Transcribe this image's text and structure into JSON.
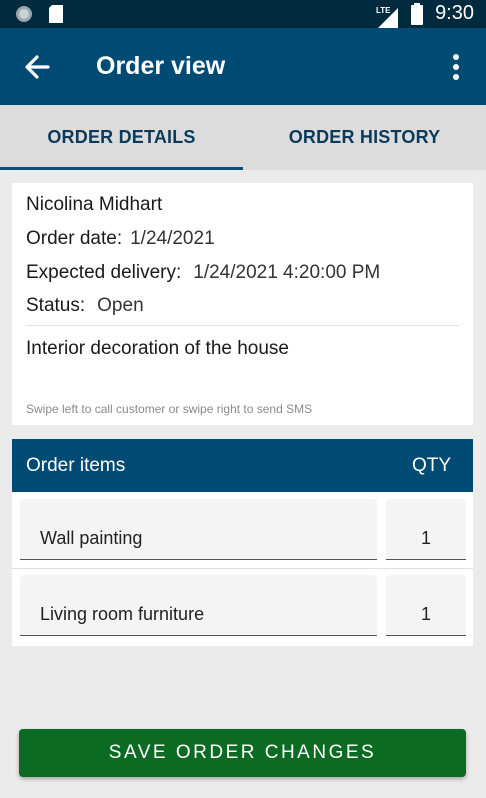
{
  "status_bar": {
    "time": "9:30",
    "network_label": "LTE",
    "icons": [
      "notification-dot-icon",
      "sd-card-icon",
      "lte-signal-icon",
      "battery-icon"
    ]
  },
  "app_bar": {
    "title": "Order view",
    "back_icon": "arrow-left-icon",
    "menu_icon": "more-vert-icon"
  },
  "tabs": [
    {
      "label": "ORDER DETAILS",
      "active": true
    },
    {
      "label": "ORDER HISTORY",
      "active": false
    }
  ],
  "details": {
    "customer_name": "Nicolina Midhart",
    "order_date_label": "Order date:",
    "order_date_value": "1/24/2021",
    "expected_delivery_label": "Expected delivery:",
    "expected_delivery_value": "1/24/2021 4:20:00 PM",
    "status_label": "Status:",
    "status_value": "Open",
    "description": "Interior decoration of the house",
    "hint": "Swipe left to call customer or swipe right to send SMS"
  },
  "order_items": {
    "header_label": "Order items",
    "qty_label": "QTY",
    "items": [
      {
        "name": "Wall painting",
        "qty": "1"
      },
      {
        "name": "Living room furniture",
        "qty": "1"
      }
    ]
  },
  "actions": {
    "save_label": "SAVE ORDER CHANGES"
  },
  "colors": {
    "status_bar": "#002a3d",
    "app_bar": "#004b73",
    "save_button": "#0c6b23"
  }
}
